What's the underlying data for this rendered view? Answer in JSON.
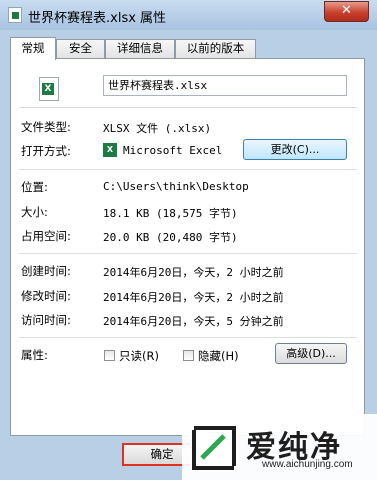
{
  "window": {
    "title": "世界杯赛程表.xlsx 属性",
    "close": "✕"
  },
  "tabs": [
    {
      "label": "常规",
      "active": true
    },
    {
      "label": "安全",
      "active": false
    },
    {
      "label": "详细信息",
      "active": false
    },
    {
      "label": "以前的版本",
      "active": false
    }
  ],
  "general": {
    "file_name": "世界杯赛程表.xlsx",
    "file_type_label": "文件类型:",
    "file_type_value": "XLSX 文件 (.xlsx)",
    "open_with_label": "打开方式:",
    "open_with_icon": "X",
    "open_with_value": "Microsoft Excel",
    "change_button": "更改(C)...",
    "location_label": "位置:",
    "location_value": "C:\\Users\\think\\Desktop",
    "size_label": "大小:",
    "size_value": "18.1 KB (18,575 字节)",
    "size_on_disk_label": "占用空间:",
    "size_on_disk_value": "20.0 KB (20,480 字节)",
    "created_label": "创建时间:",
    "created_value": "2014年6月20日，今天，2 小时之前",
    "modified_label": "修改时间:",
    "modified_value": "2014年6月20日，今天，2 小时之前",
    "accessed_label": "访问时间:",
    "accessed_value": "2014年6月20日，今天，5 分钟之前",
    "attributes_label": "属性:",
    "readonly_label": "只读(R)",
    "hidden_label": "隐藏(H)",
    "advanced_button": "高级(D)..."
  },
  "footer": {
    "ok_button": "确定"
  },
  "watermark": {
    "title": "爱纯净",
    "url": "www.aichunjing.com"
  }
}
